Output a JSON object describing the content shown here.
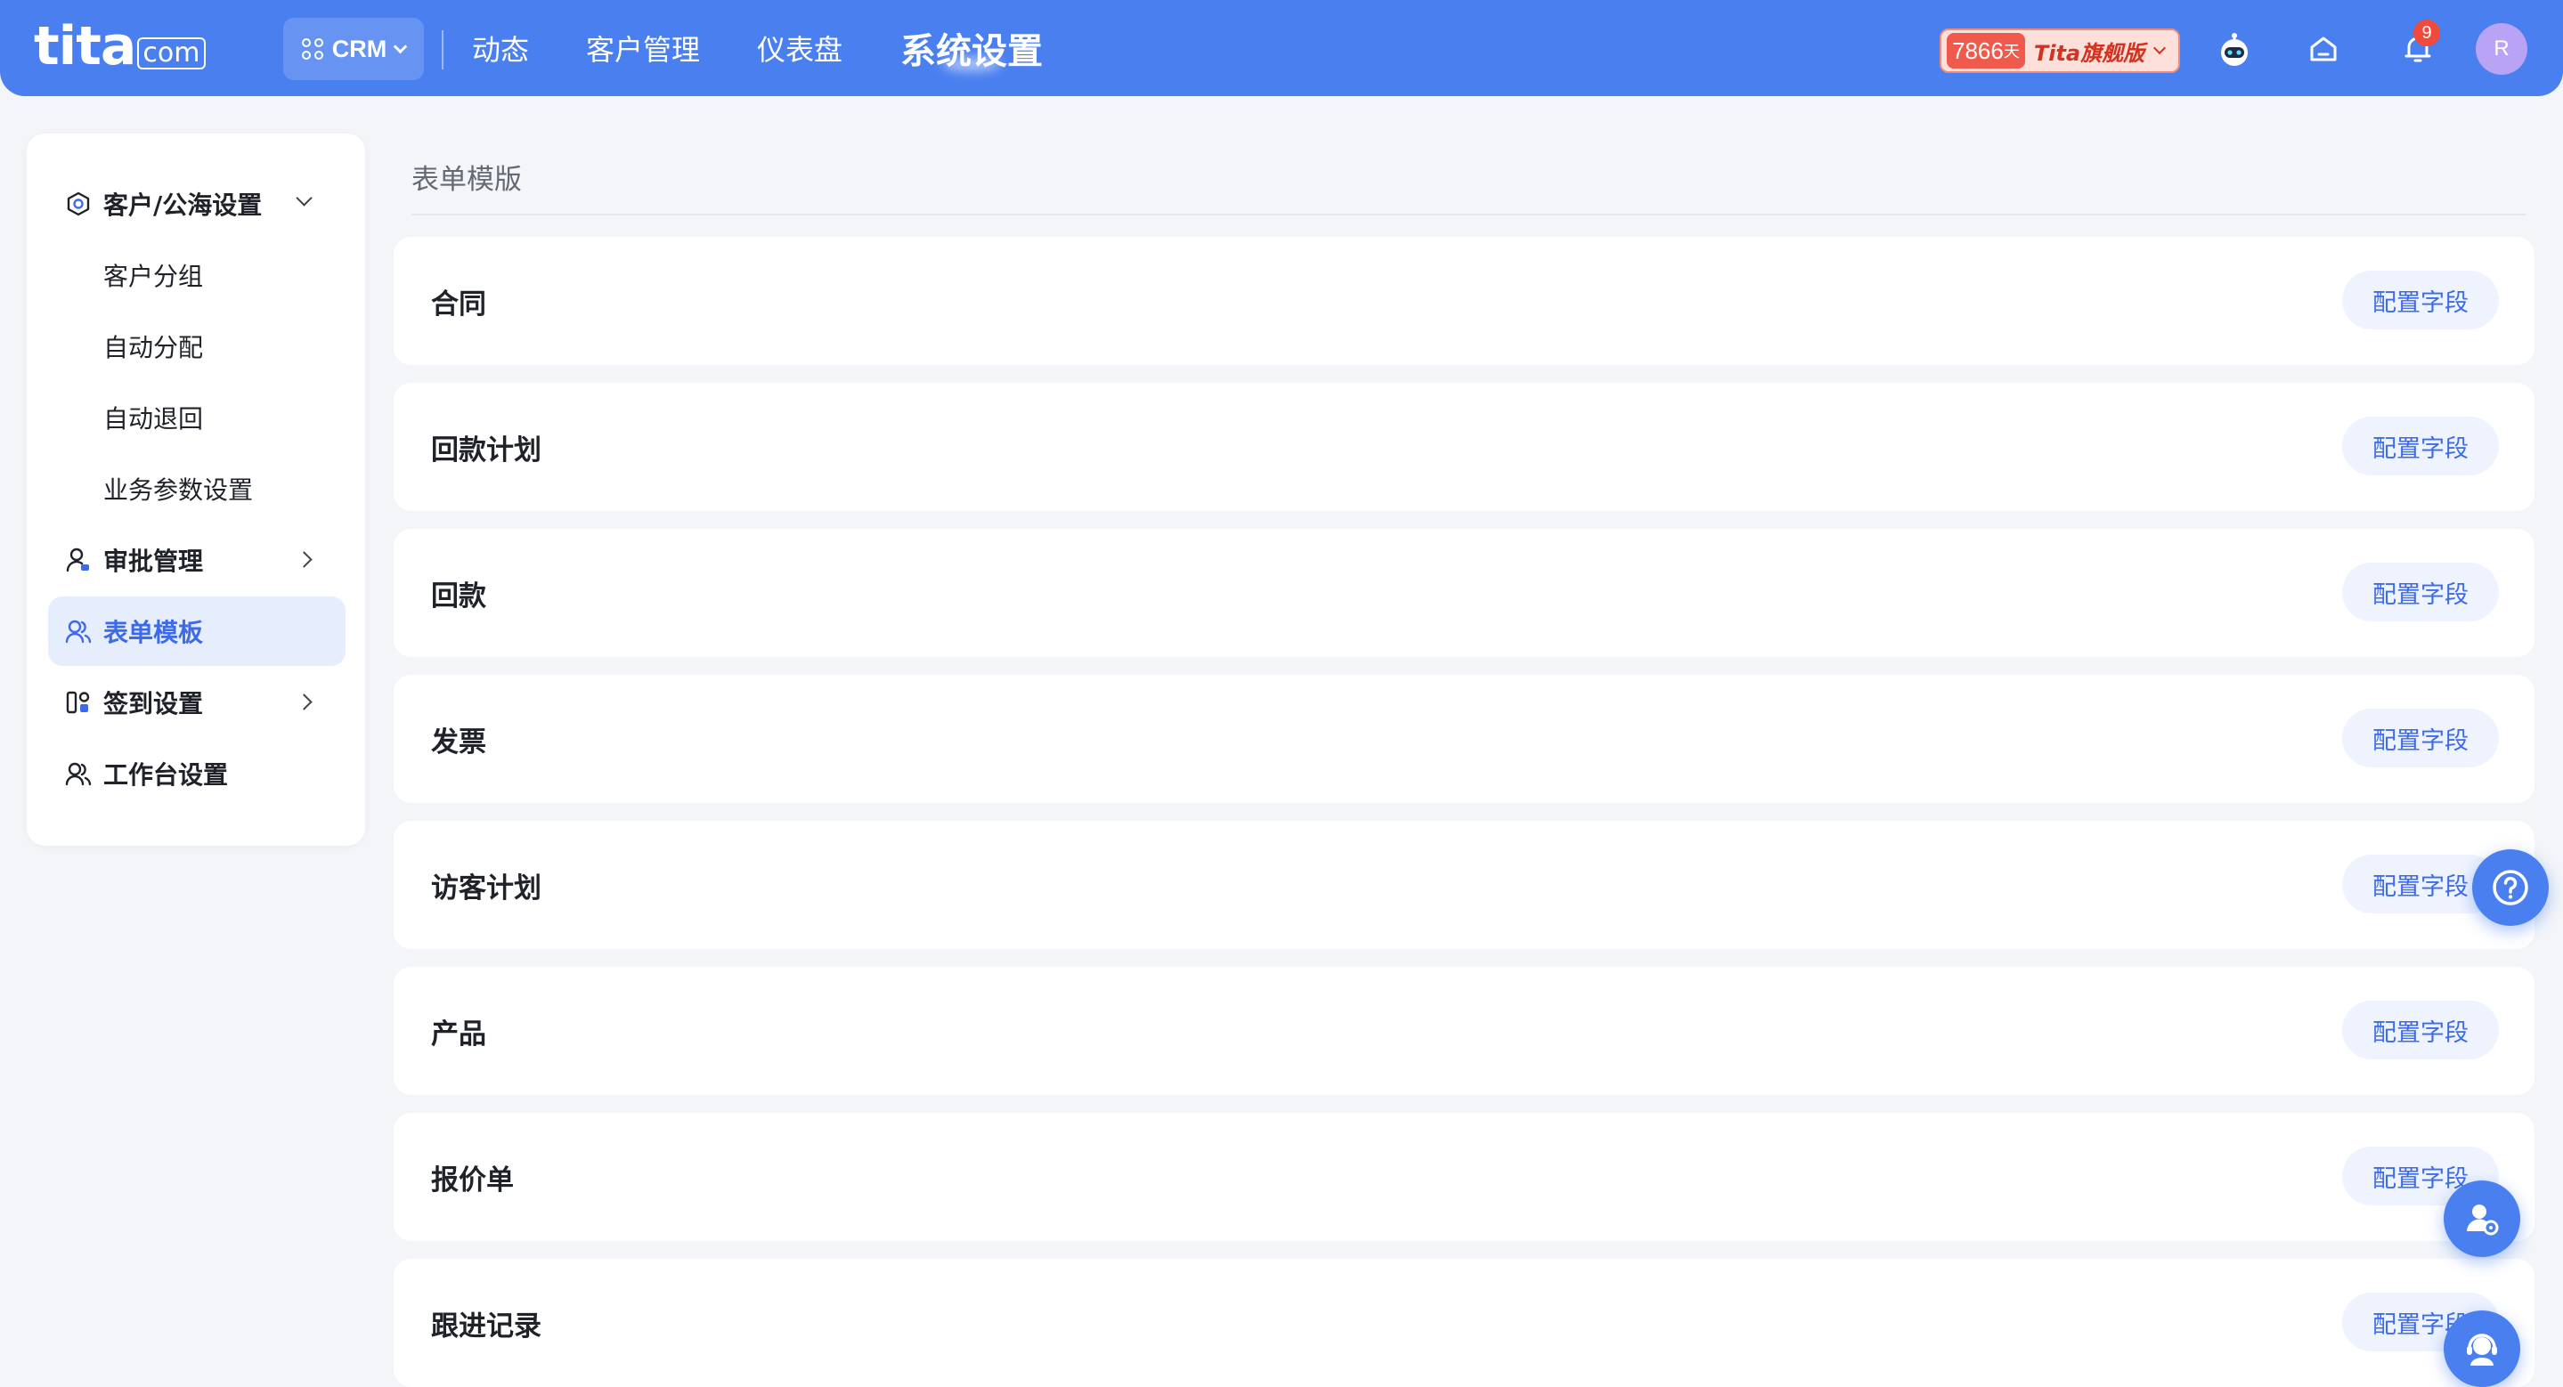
{
  "header": {
    "logo_text": "tita",
    "logo_domain": "com",
    "app_switch_label": "CRM",
    "nav": [
      {
        "label": "动态"
      },
      {
        "label": "客户管理"
      },
      {
        "label": "仪表盘"
      },
      {
        "label": "系统设置",
        "active": true
      }
    ],
    "trial_days": "7866",
    "trial_days_unit": "天",
    "edition": "Tita旗舰版",
    "notification_count": "9",
    "avatar_initial": "R"
  },
  "sidebar": {
    "groups": [
      {
        "label": "客户/公海设置",
        "icon": "hexagon-settings-icon",
        "expanded": true,
        "children": [
          "客户分组",
          "自动分配",
          "自动退回",
          "业务参数设置"
        ]
      },
      {
        "label": "审批管理",
        "icon": "user-check-icon",
        "expanded": false
      },
      {
        "label": "表单模板",
        "icon": "users-icon",
        "active": true
      },
      {
        "label": "签到设置",
        "icon": "apps-icon",
        "expanded": false
      },
      {
        "label": "工作台设置",
        "icon": "users-icon"
      }
    ]
  },
  "main": {
    "title": "表单模版",
    "config_label": "配置字段",
    "forms": [
      "合同",
      "回款计划",
      "回款",
      "发票",
      "访客计划",
      "产品",
      "报价单",
      "跟进记录"
    ]
  },
  "colors": {
    "brand": "#4a7ff0",
    "accent_text": "#3d6ae8",
    "active_bg": "#e6edfd",
    "page_bg": "#f3f5f8"
  }
}
